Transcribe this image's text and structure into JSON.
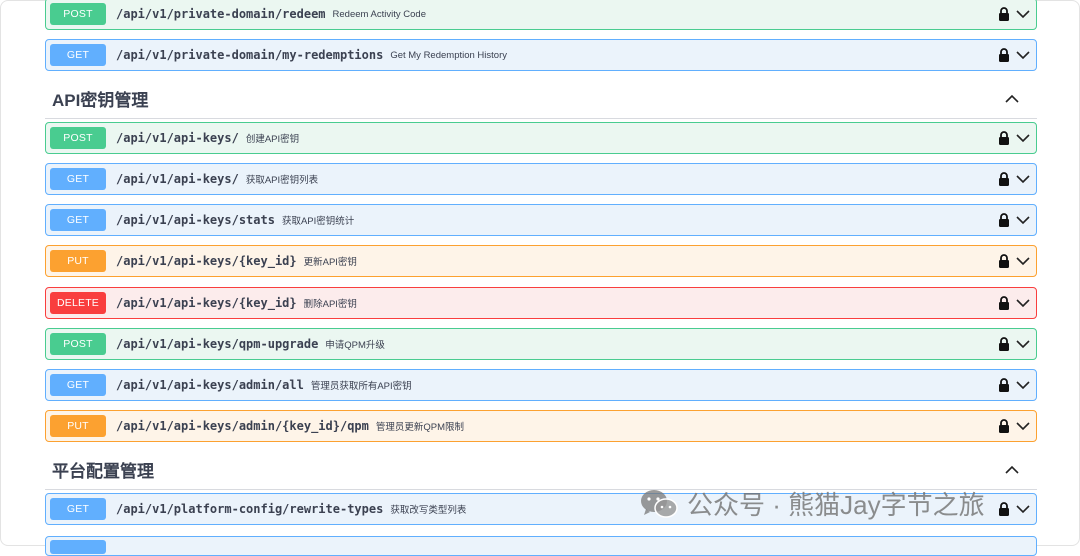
{
  "operations": [
    {
      "method": "POST",
      "path": "/api/v1/private-domain/redeem",
      "summary": "Redeem Activity Code"
    },
    {
      "method": "GET",
      "path": "/api/v1/private-domain/my-redemptions",
      "summary": "Get My Redemption History"
    },
    {
      "method": "POST",
      "path": "/api/v1/api-keys/",
      "summary": "创建API密钥"
    },
    {
      "method": "GET",
      "path": "/api/v1/api-keys/",
      "summary": "获取API密钥列表"
    },
    {
      "method": "GET",
      "path": "/api/v1/api-keys/stats",
      "summary": "获取API密钥统计"
    },
    {
      "method": "PUT",
      "path": "/api/v1/api-keys/{key_id}",
      "summary": "更新API密钥"
    },
    {
      "method": "DELETE",
      "path": "/api/v1/api-keys/{key_id}",
      "summary": "删除API密钥"
    },
    {
      "method": "POST",
      "path": "/api/v1/api-keys/qpm-upgrade",
      "summary": "申请QPM升级"
    },
    {
      "method": "GET",
      "path": "/api/v1/api-keys/admin/all",
      "summary": "管理员获取所有API密钥"
    },
    {
      "method": "PUT",
      "path": "/api/v1/api-keys/admin/{key_id}/qpm",
      "summary": "管理员更新QPM限制"
    },
    {
      "method": "GET",
      "path": "/api/v1/platform-config/rewrite-types",
      "summary": "获取改写类型列表"
    }
  ],
  "tags": [
    {
      "title": "API密钥管理"
    },
    {
      "title": "平台配置管理"
    }
  ],
  "watermark": {
    "text": "公众号 · 熊猫Jay字节之旅"
  },
  "colors": {
    "post": "#49cc90",
    "get": "#61affe",
    "put": "#fca130",
    "delete": "#f93e3e"
  }
}
